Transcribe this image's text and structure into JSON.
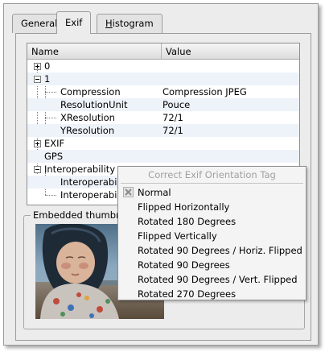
{
  "tabs": [
    {
      "label": "General"
    },
    {
      "label": "Exif"
    },
    {
      "label_underlined": "H",
      "label_rest": "istogram"
    }
  ],
  "tree": {
    "columns": {
      "name": "Name",
      "value": "Value"
    },
    "rows": [
      {
        "label": "0",
        "value": ""
      },
      {
        "label": "1",
        "value": ""
      },
      {
        "label": "Compression",
        "value": "Compression JPEG"
      },
      {
        "label": "ResolutionUnit",
        "value": "Pouce"
      },
      {
        "label": "XResolution",
        "value": "72/1"
      },
      {
        "label": "YResolution",
        "value": "72/1"
      },
      {
        "label": "EXIF",
        "value": ""
      },
      {
        "label": "GPS",
        "value": ""
      },
      {
        "label": "Interoperability",
        "value": ""
      },
      {
        "label": "Interoperabil",
        "value": ""
      },
      {
        "label": "Interoperabil",
        "value": ""
      }
    ]
  },
  "thumbnail": {
    "title": "Embedded thumbn"
  },
  "context_menu": {
    "title": "Correct Exif Orientation Tag",
    "checked_icon": "x-check-icon",
    "items": [
      "Normal",
      "Flipped Horizontally",
      "Rotated 180 Degrees",
      "Flipped Vertically",
      "Rotated 90 Degrees / Horiz. Flipped",
      "Rotated 90 Degrees",
      "Rotated 90 Degrees / Vert. Flipped",
      "Rotated 270 Degrees"
    ]
  }
}
